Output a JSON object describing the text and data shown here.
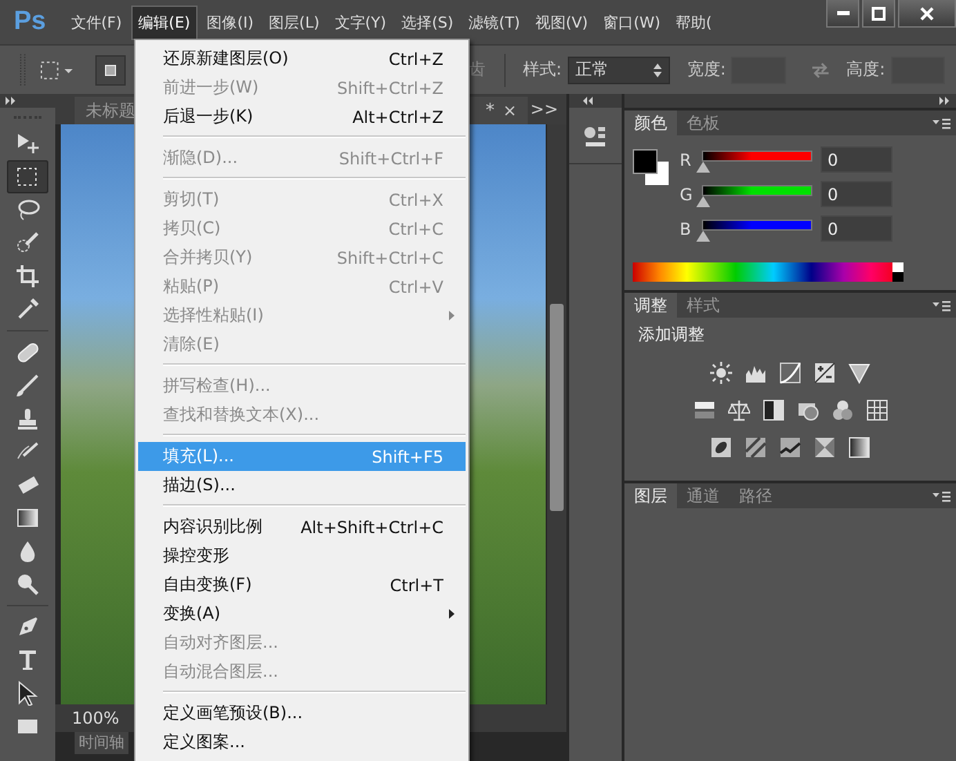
{
  "app": {
    "logo": "Ps"
  },
  "menubar": {
    "items": [
      {
        "label": "文件(F)",
        "selected": false
      },
      {
        "label": "编辑(E)",
        "selected": true
      },
      {
        "label": "图像(I)",
        "selected": false
      },
      {
        "label": "图层(L)",
        "selected": false
      },
      {
        "label": "文字(Y)",
        "selected": false
      },
      {
        "label": "选择(S)",
        "selected": false
      },
      {
        "label": "滤镜(T)",
        "selected": false
      },
      {
        "label": "视图(V)",
        "selected": false
      },
      {
        "label": "窗口(W)",
        "selected": false
      },
      {
        "label": "帮助(",
        "selected": false
      }
    ]
  },
  "options_bar": {
    "antialias_label": "齿",
    "style_label": "样式:",
    "style_value": "正常",
    "width_label": "宽度:",
    "height_label": "高度:"
  },
  "toolbar": {
    "tools": [
      {
        "kind": "move",
        "selected": false
      },
      {
        "kind": "marquee",
        "selected": true
      },
      {
        "kind": "lasso",
        "selected": false
      },
      {
        "kind": "quick_select",
        "selected": false
      },
      {
        "kind": "crop",
        "selected": false
      },
      {
        "kind": "eyedropper",
        "selected": false
      },
      {
        "kind": "separator"
      },
      {
        "kind": "healing",
        "selected": false
      },
      {
        "kind": "brush",
        "selected": false
      },
      {
        "kind": "stamp",
        "selected": false
      },
      {
        "kind": "history_brush",
        "selected": false
      },
      {
        "kind": "eraser",
        "selected": false
      },
      {
        "kind": "gradient",
        "selected": false
      },
      {
        "kind": "blur",
        "selected": false
      },
      {
        "kind": "dodge",
        "selected": false
      },
      {
        "kind": "separator"
      },
      {
        "kind": "pen",
        "selected": false
      },
      {
        "kind": "type",
        "selected": false
      },
      {
        "kind": "path_select",
        "selected": false
      },
      {
        "kind": "shape",
        "selected": false
      }
    ]
  },
  "document": {
    "tab_title": "未标题",
    "tab_modified": "*",
    "tab_close": "×",
    "collapse": ">>",
    "zoom": "100%",
    "timeline_tab": "时间轴"
  },
  "panels": {
    "color": {
      "tabs": [
        {
          "label": "颜色",
          "selected": true
        },
        {
          "label": "色板",
          "selected": false
        }
      ],
      "channels": [
        {
          "name": "R",
          "level": 0,
          "value": "0",
          "color": "#ff0000"
        },
        {
          "name": "G",
          "level": 0,
          "value": "0",
          "color": "#00e000"
        },
        {
          "name": "B",
          "level": 0,
          "value": "0",
          "color": "#0000ff"
        }
      ]
    },
    "adjustments": {
      "tabs": [
        {
          "label": "调整",
          "selected": true
        },
        {
          "label": "样式",
          "selected": false
        }
      ],
      "title": "添加调整"
    },
    "layers": {
      "tabs": [
        {
          "label": "图层",
          "selected": true
        },
        {
          "label": "通道",
          "selected": false
        },
        {
          "label": "路径",
          "selected": false
        }
      ]
    }
  },
  "edit_menu": {
    "items": [
      {
        "kind": "item",
        "label": "还原新建图层(O)",
        "shortcut": "Ctrl+Z",
        "disabled": false,
        "selected": false,
        "submenu": false
      },
      {
        "kind": "item",
        "label": "前进一步(W)",
        "shortcut": "Shift+Ctrl+Z",
        "disabled": true,
        "selected": false,
        "submenu": false
      },
      {
        "kind": "item",
        "label": "后退一步(K)",
        "shortcut": "Alt+Ctrl+Z",
        "disabled": false,
        "selected": false,
        "submenu": false
      },
      {
        "kind": "separator"
      },
      {
        "kind": "item",
        "label": "渐隐(D)...",
        "shortcut": "Shift+Ctrl+F",
        "disabled": true,
        "selected": false,
        "submenu": false
      },
      {
        "kind": "separator"
      },
      {
        "kind": "item",
        "label": "剪切(T)",
        "shortcut": "Ctrl+X",
        "disabled": true,
        "selected": false,
        "submenu": false
      },
      {
        "kind": "item",
        "label": "拷贝(C)",
        "shortcut": "Ctrl+C",
        "disabled": true,
        "selected": false,
        "submenu": false
      },
      {
        "kind": "item",
        "label": "合并拷贝(Y)",
        "shortcut": "Shift+Ctrl+C",
        "disabled": true,
        "selected": false,
        "submenu": false
      },
      {
        "kind": "item",
        "label": "粘贴(P)",
        "shortcut": "Ctrl+V",
        "disabled": true,
        "selected": false,
        "submenu": false
      },
      {
        "kind": "item",
        "label": "选择性粘贴(I)",
        "disabled": true,
        "selected": false,
        "submenu": true
      },
      {
        "kind": "item",
        "label": "清除(E)",
        "disabled": true,
        "selected": false,
        "submenu": false
      },
      {
        "kind": "separator"
      },
      {
        "kind": "item",
        "label": "拼写检查(H)...",
        "disabled": true,
        "selected": false,
        "submenu": false
      },
      {
        "kind": "item",
        "label": "查找和替换文本(X)...",
        "disabled": true,
        "selected": false,
        "submenu": false
      },
      {
        "kind": "separator"
      },
      {
        "kind": "item",
        "label": "填充(L)...",
        "shortcut": "Shift+F5",
        "disabled": false,
        "selected": true,
        "submenu": false
      },
      {
        "kind": "item",
        "label": "描边(S)...",
        "disabled": false,
        "selected": false,
        "submenu": false
      },
      {
        "kind": "separator"
      },
      {
        "kind": "item",
        "label": "内容识别比例",
        "shortcut": "Alt+Shift+Ctrl+C",
        "disabled": false,
        "selected": false,
        "submenu": false
      },
      {
        "kind": "item",
        "label": "操控变形",
        "disabled": false,
        "selected": false,
        "submenu": false
      },
      {
        "kind": "item",
        "label": "自由变换(F)",
        "shortcut": "Ctrl+T",
        "disabled": false,
        "selected": false,
        "submenu": false
      },
      {
        "kind": "item",
        "label": "变换(A)",
        "disabled": false,
        "selected": false,
        "submenu": true
      },
      {
        "kind": "item",
        "label": "自动对齐图层...",
        "disabled": true,
        "selected": false,
        "submenu": false
      },
      {
        "kind": "item",
        "label": "自动混合图层...",
        "disabled": true,
        "selected": false,
        "submenu": false
      },
      {
        "kind": "separator"
      },
      {
        "kind": "item",
        "label": "定义画笔预设(B)...",
        "disabled": false,
        "selected": false,
        "submenu": false
      },
      {
        "kind": "item",
        "label": "定义图案...",
        "disabled": false,
        "selected": false,
        "submenu": false
      }
    ]
  }
}
